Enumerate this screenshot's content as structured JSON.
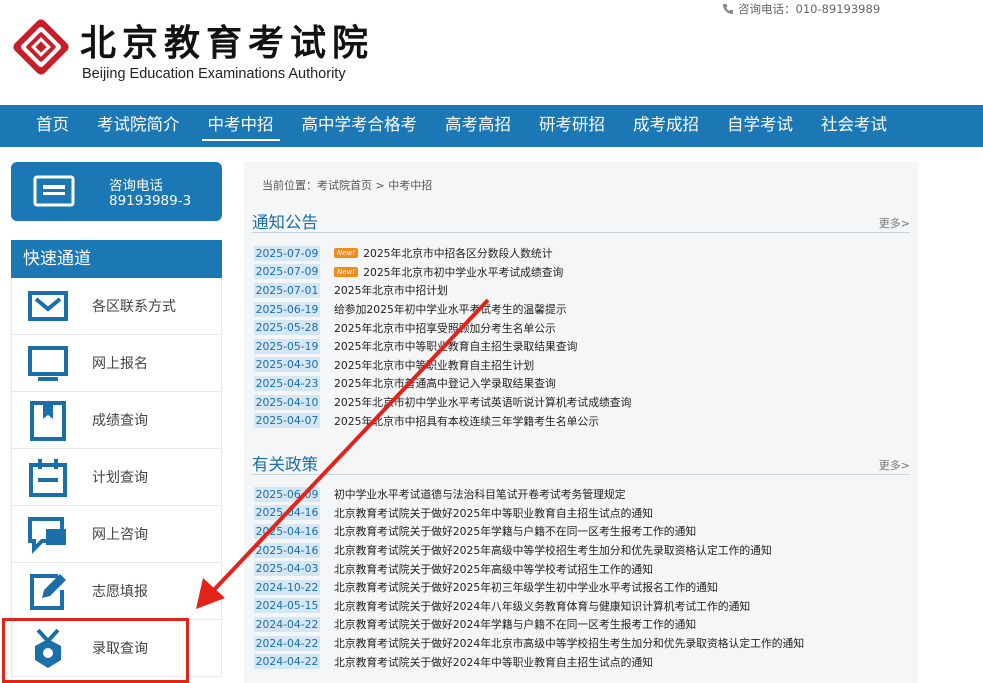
{
  "header": {
    "title": "北京教育考试院",
    "subtitle": "Beijing Education Examinations Authority",
    "hotline": "咨询电话：010-89193989"
  },
  "nav": {
    "items": [
      {
        "label": "首页",
        "active": false
      },
      {
        "label": "考试院简介",
        "active": false
      },
      {
        "label": "中考中招",
        "active": true
      },
      {
        "label": "高中学考合格考",
        "active": false
      },
      {
        "label": "高考高招",
        "active": false
      },
      {
        "label": "研考研招",
        "active": false
      },
      {
        "label": "成考成招",
        "active": false
      },
      {
        "label": "自学考试",
        "active": false
      },
      {
        "label": "社会考试",
        "active": false
      }
    ]
  },
  "sidebar": {
    "hotline_label": "咨询电话",
    "hotline_number": "89193989-3",
    "quick_title": "快速通道",
    "items": [
      {
        "label": "各区联系方式",
        "icon": "envelope-icon"
      },
      {
        "label": "网上报名",
        "icon": "monitor-icon"
      },
      {
        "label": "成绩查询",
        "icon": "bookmark-icon"
      },
      {
        "label": "计划查询",
        "icon": "calendar-icon"
      },
      {
        "label": "网上咨询",
        "icon": "chat-icon"
      },
      {
        "label": "志愿填报",
        "icon": "edit-icon"
      },
      {
        "label": "录取查询",
        "icon": "medal-icon"
      }
    ]
  },
  "main": {
    "breadcrumb": "当前位置：考试院首页 > 中考中招",
    "notices": {
      "title": "通知公告",
      "more": "更多>",
      "items": [
        {
          "date": "2025-07-09",
          "new": true,
          "title": "2025年北京市中招各区分数段人数统计"
        },
        {
          "date": "2025-07-09",
          "new": true,
          "title": "2025年北京市初中学业水平考试成绩查询"
        },
        {
          "date": "2025-07-01",
          "new": false,
          "title": "2025年北京市中招计划"
        },
        {
          "date": "2025-06-19",
          "new": false,
          "title": "给参加2025年初中学业水平考试考生的温馨提示"
        },
        {
          "date": "2025-05-28",
          "new": false,
          "title": "2025年北京市中招享受照顾加分考生名单公示"
        },
        {
          "date": "2025-05-19",
          "new": false,
          "title": "2025年北京市中等职业教育自主招生录取结果查询"
        },
        {
          "date": "2025-04-30",
          "new": false,
          "title": "2025年北京市中等职业教育自主招生计划"
        },
        {
          "date": "2025-04-23",
          "new": false,
          "title": "2025年北京市普通高中登记入学录取结果查询"
        },
        {
          "date": "2025-04-10",
          "new": false,
          "title": "2025年北京市初中学业水平考试英语听说计算机考试成绩查询"
        },
        {
          "date": "2025-04-07",
          "new": false,
          "title": "2025年北京市中招具有本校连续三年学籍考生名单公示"
        }
      ]
    },
    "policies": {
      "title": "有关政策",
      "more": "更多>",
      "items": [
        {
          "date": "2025-06-09",
          "title": "初中学业水平考试道德与法治科目笔试开卷考试考务管理规定"
        },
        {
          "date": "2025-04-16",
          "title": "北京教育考试院关于做好2025年中等职业教育自主招生试点的通知"
        },
        {
          "date": "2025-04-16",
          "title": "北京教育考试院关于做好2025年学籍与户籍不在同一区考生报考工作的通知"
        },
        {
          "date": "2025-04-16",
          "title": "北京教育考试院关于做好2025年高级中等学校招生考生加分和优先录取资格认定工作的通知"
        },
        {
          "date": "2025-04-03",
          "title": "北京教育考试院关于做好2025年高级中等学校考试招生工作的通知"
        },
        {
          "date": "2024-10-22",
          "title": "北京教育考试院关于做好2025年初三年级学生初中学业水平考试报名工作的通知"
        },
        {
          "date": "2024-05-15",
          "title": "北京教育考试院关于做好2024年八年级义务教育体育与健康知识计算机考试工作的通知"
        },
        {
          "date": "2024-04-22",
          "title": "北京教育考试院关于做好2024年学籍与户籍不在同一区考生报考工作的通知"
        },
        {
          "date": "2024-04-22",
          "title": "北京教育考试院关于做好2024年北京市高级中等学校招生考生加分和优先录取资格认定工作的通知"
        },
        {
          "date": "2024-04-22",
          "title": "北京教育考试院关于做好2024年中等职业教育自主招生试点的通知"
        }
      ]
    }
  },
  "new_badge_text": "New!",
  "colors": {
    "brand_blue": "#1b78b4",
    "date_bg": "#d5e6f4",
    "annotation_red": "#e2231a",
    "new_badge": "#f08c1e",
    "logo_red": "#c81e2a"
  }
}
